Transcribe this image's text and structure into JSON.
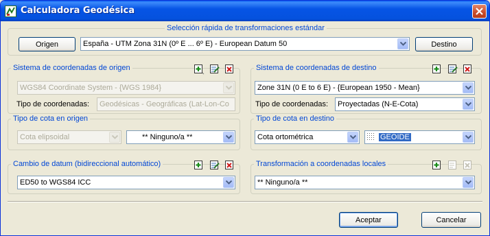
{
  "window": {
    "title": "Calculadora Geodésica",
    "icon": "app-icon",
    "close_icon": "close-icon"
  },
  "quick": {
    "legend": "Selección rápida de transformaciones estándar",
    "origin_button": "Origen",
    "destination_button": "Destino",
    "selected": "España - UTM Zona 31N (0º E ... 6º E) - European Datum 50"
  },
  "source": {
    "legend": "Sistema de coordenadas de origen",
    "system_value": "WGS84 Coordinate System - {WGS 1984}",
    "coord_type_label": "Tipo de coordenadas:",
    "coord_type_value": "Geodésicas - Geográficas (Lat-Lon-Co"
  },
  "source_height": {
    "legend": "Tipo de cota en origen",
    "type_value": "Cota elipsoidal",
    "model_value": "** Ninguno/a **"
  },
  "destination": {
    "legend": "Sistema de coordenadas de destino",
    "system_value": "Zone 31N (0 E to 6 E) - {European 1950 - Mean}",
    "coord_type_label": "Tipo de coordenadas:",
    "coord_type_value": "Proyectadas (N-E-Cota)"
  },
  "destination_height": {
    "legend": "Tipo de cota en destino",
    "type_value": "Cota ortométrica",
    "model_value": "GEOIDE"
  },
  "datum": {
    "legend": "Cambio de datum  (bidireccional automático)",
    "value": "ED50 to WGS84 ICC"
  },
  "local": {
    "legend": "Transformación a coordenadas locales",
    "value": "** Ninguno/a **"
  },
  "footer": {
    "accept_label": "Aceptar",
    "cancel_label": "Cancelar"
  },
  "icons": [
    "add-icon",
    "edit-icon",
    "delete-icon",
    "dropdown-arrow-icon",
    "grid-icon"
  ],
  "colors": {
    "titlebar": "#0654e5",
    "legend": "#0046d5",
    "window_bg": "#ece9d8",
    "selection": "#316ac5"
  }
}
